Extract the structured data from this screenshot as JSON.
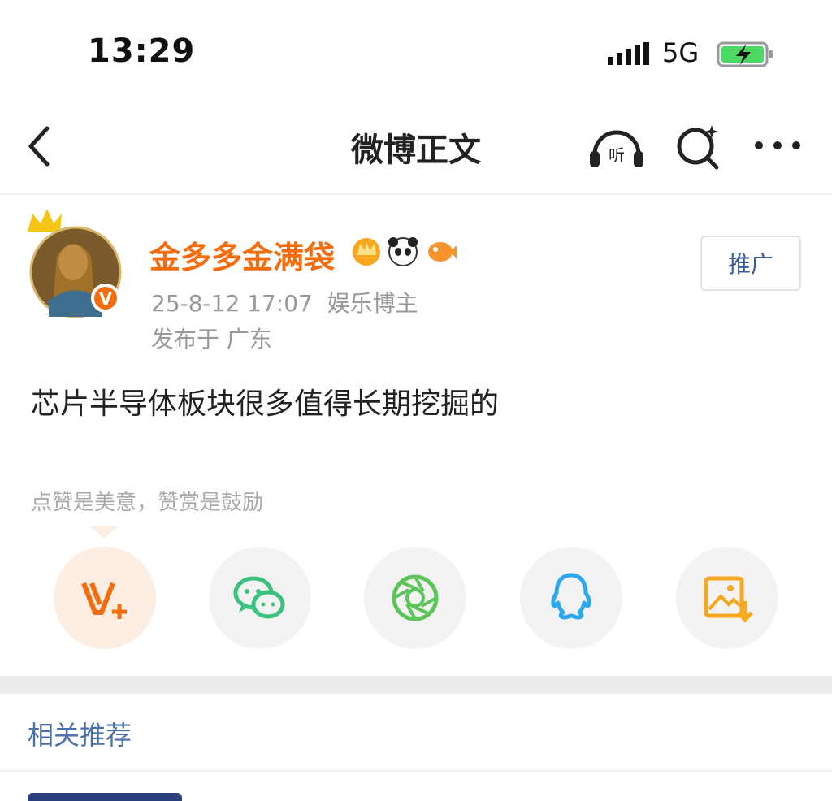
{
  "status_bar": {
    "time": "13:29",
    "network": "5G"
  },
  "nav": {
    "title": "微博正文",
    "listen_label": "听"
  },
  "post": {
    "author": "金多多金满袋",
    "meta": "25-8-12 17:07  娱乐博主",
    "location": "发布于 广东",
    "promote_label": "推广",
    "verified_badge": "V",
    "content": "芯片半导体板块很多值得长期挖掘的",
    "tip": "点赞是美意，赞赏是鼓励"
  },
  "share_buttons": [
    "v-plus-icon",
    "wechat-icon",
    "moments-icon",
    "qq-icon",
    "save-image-icon"
  ],
  "related": {
    "label": "相关推荐"
  },
  "colors": {
    "accent": "#f36d0f",
    "link": "#4a6ea8",
    "wechat": "#3bc27e",
    "qq": "#2aa8f0",
    "moments": "#5cc55a"
  }
}
